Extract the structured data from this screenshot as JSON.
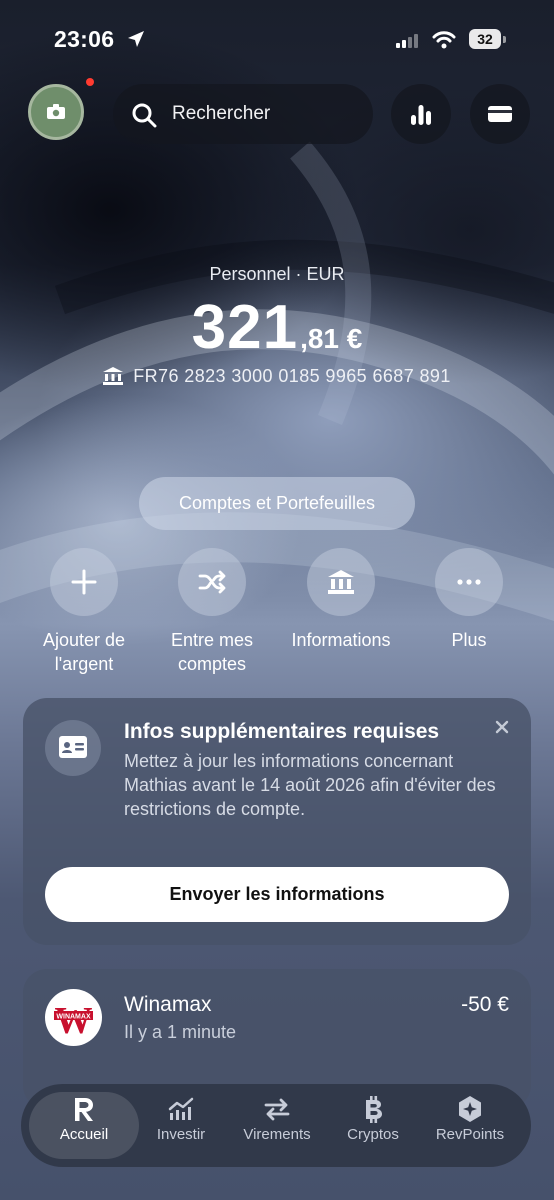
{
  "status_bar": {
    "time": "23:06",
    "battery": "32"
  },
  "top_bar": {
    "search_placeholder": "Rechercher"
  },
  "account": {
    "label": "Personnel · EUR",
    "balance_int": "321",
    "balance_dec": ",81 €",
    "iban": "FR76 2823 3000 0185 9965 6687 891",
    "accounts_button": "Comptes et Portefeuilles"
  },
  "actions": [
    {
      "label1": "Ajouter de",
      "label2": "l'argent",
      "icon": "plus-icon"
    },
    {
      "label1": "Entre mes",
      "label2": "comptes",
      "icon": "shuffle-icon"
    },
    {
      "label1": "Informations",
      "label2": "",
      "icon": "bank-icon"
    },
    {
      "label1": "Plus",
      "label2": "",
      "icon": "more-icon"
    }
  ],
  "info_card": {
    "title": "Infos supplémentaires requises",
    "description": "Mettez à jour les informations concernant Mathias avant le 14 août 2026 afin d'éviter des restrictions de compte.",
    "cta": "Envoyer les informations"
  },
  "transaction": {
    "name": "Winamax",
    "time": "Il y a 1 minute",
    "amount": "-50 €",
    "logo_letter": "W",
    "logo_text": "WINAMAX"
  },
  "nav": [
    {
      "label": "Accueil",
      "icon": "revolut-r-icon",
      "active": true
    },
    {
      "label": "Investir",
      "icon": "chart-icon",
      "active": false
    },
    {
      "label": "Virements",
      "icon": "transfer-icon",
      "active": false
    },
    {
      "label": "Cryptos",
      "icon": "bitcoin-icon",
      "active": false
    },
    {
      "label": "RevPoints",
      "icon": "revpoints-icon",
      "active": false
    }
  ],
  "colors": {
    "accent_red": "#ff3b30",
    "winamax_red": "#c8102e"
  }
}
